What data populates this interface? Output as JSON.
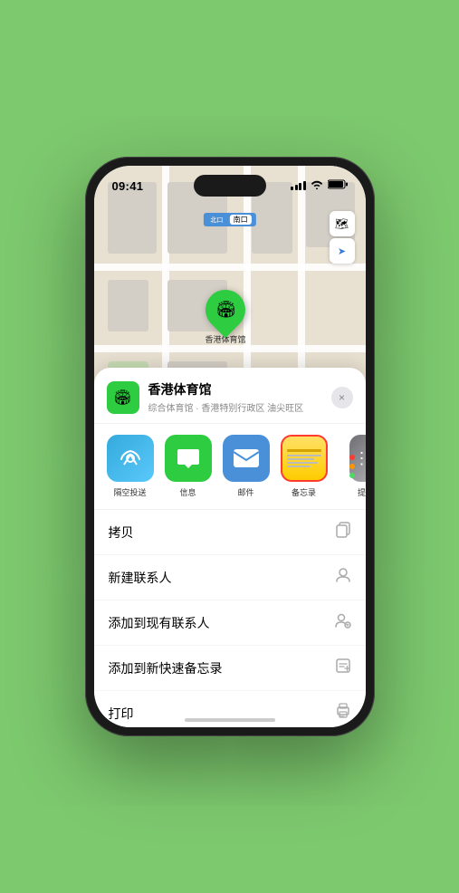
{
  "statusBar": {
    "time": "09:41",
    "locationArrow": "▲"
  },
  "map": {
    "label": "南口",
    "venuePinLabel": "香港体育馆",
    "mapIcon": "🗺",
    "locationIcon": "➤"
  },
  "venueCard": {
    "name": "香港体育馆",
    "description": "综合体育馆 · 香港特别行政区 油尖旺区",
    "closeLabel": "×"
  },
  "shareRow": {
    "items": [
      {
        "id": "airdrop",
        "label": "隔空投送",
        "icon": "📡"
      },
      {
        "id": "messages",
        "label": "信息",
        "icon": "💬"
      },
      {
        "id": "mail",
        "label": "邮件",
        "icon": "✉"
      },
      {
        "id": "notes",
        "label": "备忘录",
        "icon": "notes",
        "selected": true
      },
      {
        "id": "more",
        "label": "提",
        "icon": "more"
      }
    ]
  },
  "actionList": [
    {
      "label": "拷贝",
      "icon": "copy"
    },
    {
      "label": "新建联系人",
      "icon": "person"
    },
    {
      "label": "添加到现有联系人",
      "icon": "person-add"
    },
    {
      "label": "添加到新快速备忘录",
      "icon": "memo"
    },
    {
      "label": "打印",
      "icon": "print"
    }
  ]
}
